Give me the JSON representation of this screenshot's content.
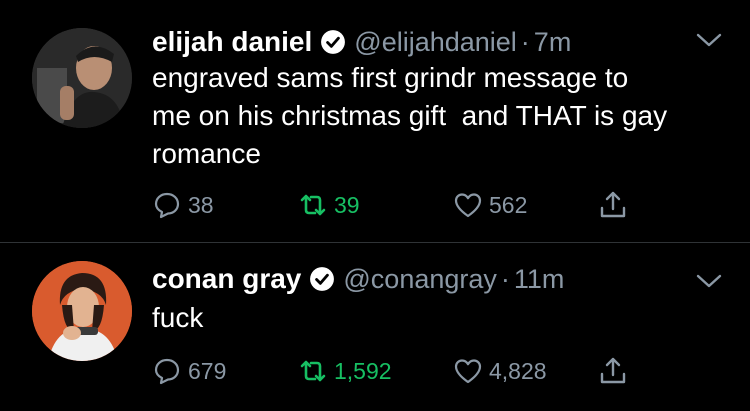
{
  "tweets": [
    {
      "name": "elijah daniel",
      "handle": "@elijahdaniel",
      "separator": "·",
      "time": "7m",
      "text": "engraved sams first grindr message to\nme on his christmas gift  and THAT is gay\nromance",
      "replies": "38",
      "retweets": "39",
      "likes": "562"
    },
    {
      "name": "conan gray",
      "handle": "@conangray",
      "separator": "·",
      "time": "11m",
      "text": "fuck",
      "replies": "679",
      "retweets": "1,592",
      "likes": "4,828"
    }
  ],
  "colors": {
    "background": "#000000",
    "secondary_text": "#8b98a5",
    "retweet_green": "#17bf63",
    "divider": "#2f3336"
  },
  "icons": [
    "verified-badge-icon",
    "chevron-down-icon",
    "reply-icon",
    "retweet-icon",
    "like-icon",
    "share-icon"
  ]
}
